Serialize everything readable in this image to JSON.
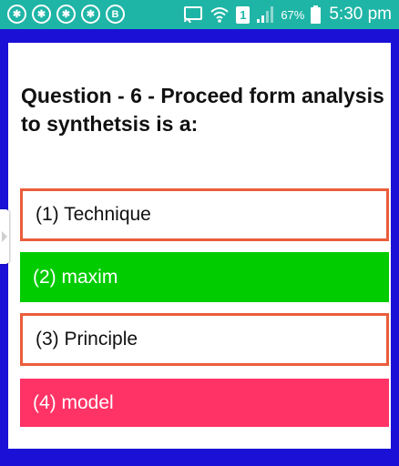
{
  "status_bar": {
    "notifications": [
      {
        "icon": "spoke-wheel-icon",
        "glyph": "✱"
      },
      {
        "icon": "spoke-wheel-icon",
        "glyph": "✱"
      },
      {
        "icon": "spoke-wheel-icon",
        "glyph": "✱"
      },
      {
        "icon": "spoke-wheel-icon",
        "glyph": "✱"
      },
      {
        "icon": "b-circle-icon",
        "glyph": "B"
      }
    ],
    "sim_slot": "1",
    "battery_percent": "67%",
    "time": "5:30 pm",
    "colors": {
      "bar": "#1fb5a6"
    }
  },
  "quiz": {
    "question": "Question - 6 - Proceed form analysis to synthetsis is a:",
    "options": [
      {
        "label": "(1) Technique",
        "state": "outlined"
      },
      {
        "label": "(2) maxim",
        "state": "correct"
      },
      {
        "label": "(3) Principle",
        "state": "outlined"
      },
      {
        "label": "(4) model",
        "state": "wrong"
      }
    ],
    "colors": {
      "frame": "#1a10d6",
      "outline": "#ea5d3a",
      "correct": "#00cc00",
      "wrong": "#ff3366"
    }
  }
}
